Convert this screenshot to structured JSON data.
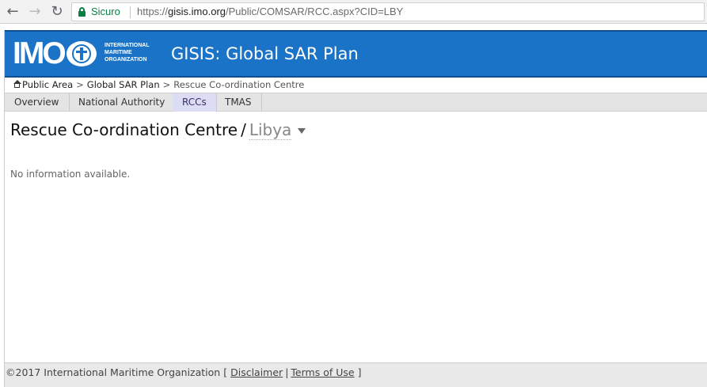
{
  "browser": {
    "secure_label": "Sicuro",
    "url_scheme": "https://",
    "url_host": "gisis.imo.org",
    "url_path": "/Public/COMSAR/RCC.aspx?CID=LBY"
  },
  "header": {
    "logo": {
      "wordmark": "IMO",
      "line1": "INTERNATIONAL",
      "line2": "MARITIME",
      "line3": "ORGANIZATION"
    },
    "title": "GISIS: Global SAR Plan"
  },
  "breadcrumb": {
    "home": "Public Area",
    "level1": "Global SAR Plan",
    "current": "Rescue Co-ordination Centre"
  },
  "tabs": [
    {
      "label": "Overview",
      "active": false
    },
    {
      "label": "National Authority",
      "active": false
    },
    {
      "label": "RCCs",
      "active": true
    },
    {
      "label": "TMAS",
      "active": false
    }
  ],
  "main": {
    "heading": "Rescue Co-ordination Centre",
    "separator": "/",
    "country": "Libya",
    "message": "No information available."
  },
  "footer": {
    "copyright": "©2017 International Maritime Organization",
    "open_bracket": "[",
    "disclaimer": "Disclaimer",
    "divider": "|",
    "terms": "Terms of Use",
    "close_bracket": "]"
  },
  "colors": {
    "banner": "#1a73c6",
    "tab_active": "#dcdcf4",
    "secure": "#0b8043"
  }
}
